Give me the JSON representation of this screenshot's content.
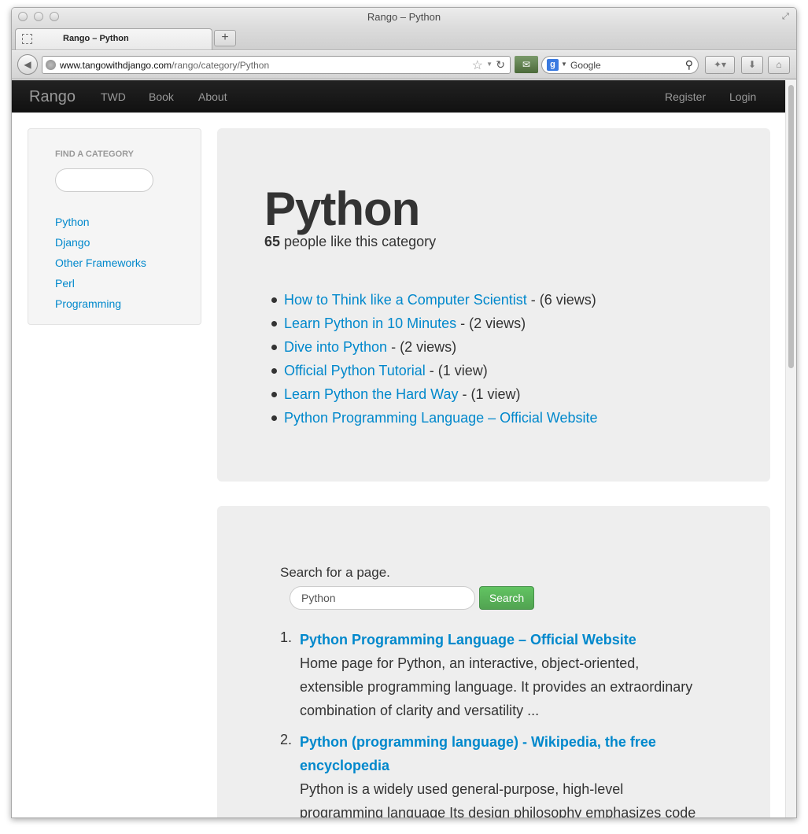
{
  "window": {
    "title": "Rango – Python"
  },
  "tab": {
    "label": "Rango – Python",
    "new_tab": "+"
  },
  "toolbar": {
    "url_host": "www.tangowithdjango.com",
    "url_path": "/rango/category/Python",
    "search_engine_letter": "g",
    "search_placeholder": "Google"
  },
  "icons": {
    "back": "back-arrow-icon",
    "globe": "globe-icon",
    "star": "bookmark-star-icon",
    "reload": "reload-icon",
    "mail": "mail-icon",
    "search": "magnifier-icon",
    "bookmarks": "bookmarks-icon",
    "download": "download-icon",
    "home": "home-icon"
  },
  "navbar": {
    "brand": "Rango",
    "links": [
      "TWD",
      "Book",
      "About"
    ],
    "right_links": [
      "Register",
      "Login"
    ]
  },
  "sidebar": {
    "header": "Find a Category",
    "categories": [
      "Python",
      "Django",
      "Other Frameworks",
      "Perl",
      "Programming"
    ]
  },
  "category": {
    "name": "Python",
    "likes": "65",
    "likes_text": " people like this category",
    "pages": [
      {
        "title": "How to Think like a Computer Scientist",
        "views": " - (6 views)"
      },
      {
        "title": "Learn Python in 10 Minutes",
        "views": " - (2 views)"
      },
      {
        "title": "Dive into Python",
        "views": " - (2 views)"
      },
      {
        "title": "Official Python Tutorial",
        "views": " - (1 view)"
      },
      {
        "title": "Learn Python the Hard Way",
        "views": " - (1 view)"
      },
      {
        "title": "Python Programming Language – Official Website",
        "views": ""
      }
    ]
  },
  "search": {
    "prompt": "Search for a page.",
    "query": "Python",
    "button": "Search",
    "results": [
      {
        "num": "1.",
        "title": "Python Programming Language – Official Website",
        "summary": "Home page for Python, an interactive, object-oriented, extensible programming language. It provides an extraordinary combination of clarity and versatility ..."
      },
      {
        "num": "2.",
        "title": "Python (programming language) - Wikipedia, the free encyclopedia",
        "summary": "Python is a widely used general-purpose, high-level programming language Its design philosophy emphasizes code readability, and"
      }
    ]
  },
  "colors": {
    "link": "#0088cc",
    "navbar": "#1b1b1b",
    "well": "#eeeeee",
    "button_green": "#51a351"
  }
}
